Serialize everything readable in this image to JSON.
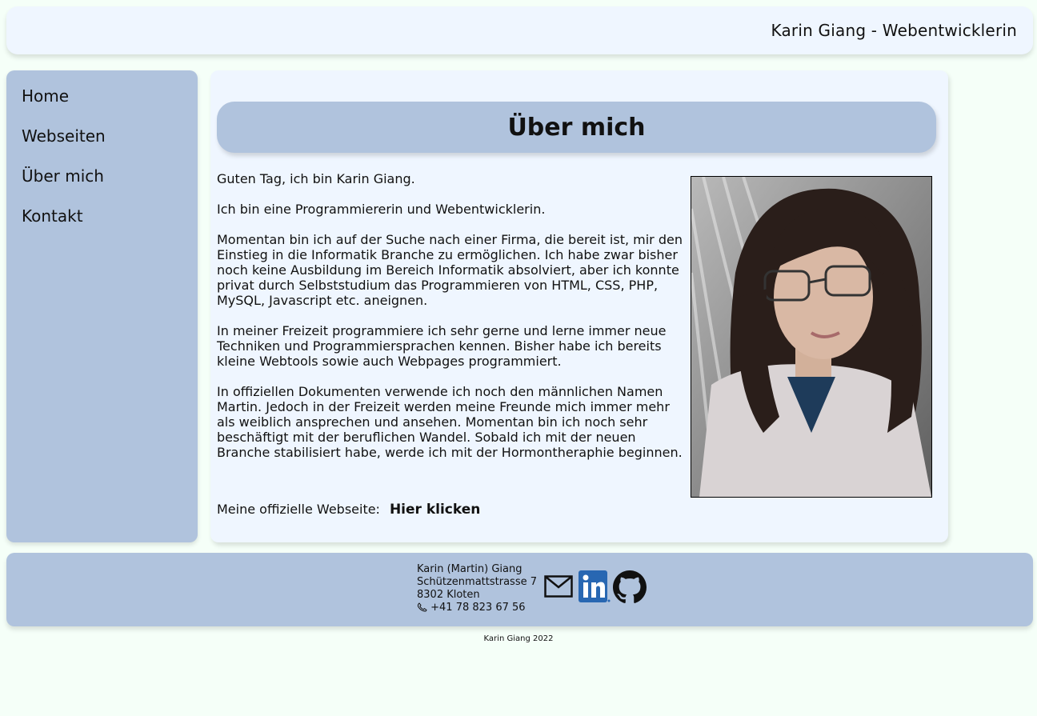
{
  "header": {
    "site_title": "Karin Giang - Webentwicklerin"
  },
  "nav": [
    {
      "label": "Home"
    },
    {
      "label": "Webseiten"
    },
    {
      "label": "Über mich"
    },
    {
      "label": "Kontakt"
    }
  ],
  "main": {
    "title": "Über mich",
    "paragraphs": [
      "Guten Tag, ich bin Karin Giang.",
      "Ich bin eine Programmiererin und Webentwicklerin.",
      "Momentan bin ich auf der Suche nach einer Firma, die bereit ist, mir den Einstieg in die Informatik Branche zu ermöglichen. Ich habe zwar bisher noch keine Ausbildung im Bereich Informatik absolviert, aber ich konnte privat durch Selbststudium das Programmieren von HTML, CSS, PHP, MySQL, Javascript etc. aneignen.",
      "In meiner Freizeit programmiere ich sehr gerne und lerne immer neue Techniken und Programmiersprachen kennen. Bisher habe ich bereits kleine Webtools sowie auch Webpages programmiert.",
      "In offiziellen Dokumenten verwende ich noch den männlichen Namen Martin. Jedoch in der Freizeit werden meine Freunde mich immer mehr als weiblich ansprechen und ansehen. Momentan bin ich noch sehr beschäftigt mit der beruflichen Wandel. Sobald ich mit der neuen Branche stabilisiert habe, werde ich mit der Hormontheraphie beginnen."
    ],
    "website_label": "Meine offizielle Webseite:",
    "website_link": "Hier klicken"
  },
  "footer": {
    "name": "Karin (Martin) Giang",
    "street": "Schützenmattstrasse 7",
    "city": "8302 Kloten",
    "phone": "+41 78 823 67 56",
    "icons": [
      "mail-icon",
      "linkedin-icon",
      "github-icon"
    ],
    "linkedin_color": "#2867b2",
    "copyright": "Karin Giang 2022"
  },
  "colors": {
    "page_bg": "#f5fff8",
    "panel_bg": "#eff6ff",
    "accent": "#b0c3dd"
  }
}
